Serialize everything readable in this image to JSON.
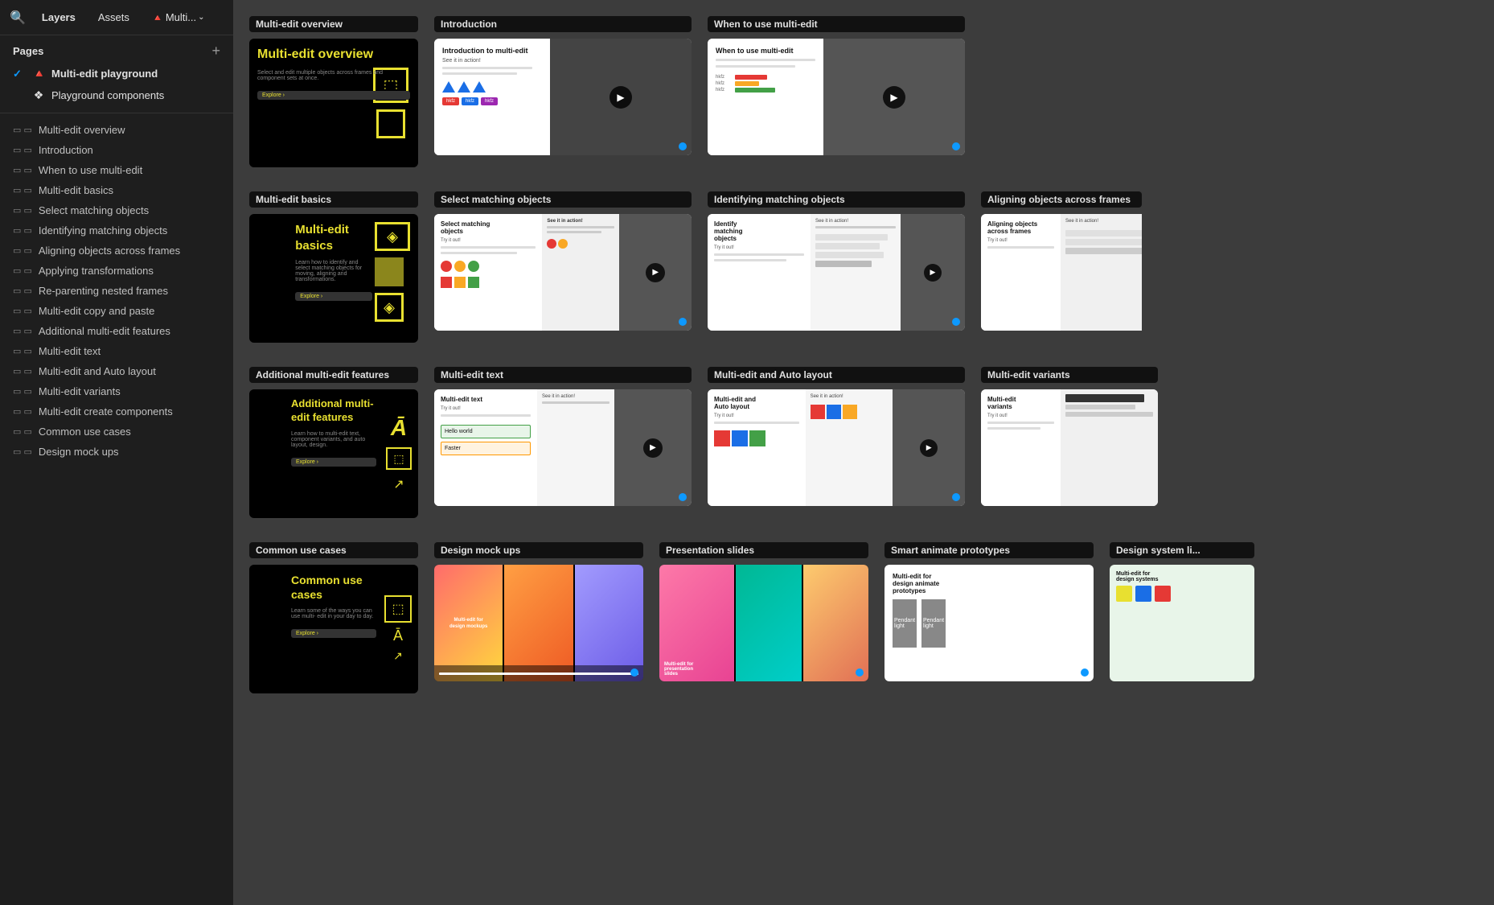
{
  "topbar": {
    "search_icon": "🔍",
    "layers_label": "Layers",
    "assets_label": "Assets",
    "multi_label": "Multi...",
    "chevron": "⌄"
  },
  "sidebar": {
    "pages_label": "Pages",
    "add_icon": "+",
    "pages": [
      {
        "id": "multi-edit-playground",
        "label": "Multi-edit playground",
        "icon": "🔺",
        "active": true,
        "check": "✓"
      },
      {
        "id": "playground-components",
        "label": "Playground components",
        "icon": "❖",
        "active": false
      }
    ],
    "layers": [
      {
        "id": "multi-edit-overview",
        "label": "Multi-edit overview"
      },
      {
        "id": "introduction",
        "label": "Introduction"
      },
      {
        "id": "when-to-use-multi-edit",
        "label": "When to use multi-edit"
      },
      {
        "id": "multi-edit-basics",
        "label": "Multi-edit basics"
      },
      {
        "id": "select-matching-objects",
        "label": "Select matching objects"
      },
      {
        "id": "identifying-matching-objects",
        "label": "Identifying matching objects"
      },
      {
        "id": "aligning-objects-across-frames",
        "label": "Aligning objects across frames"
      },
      {
        "id": "applying-transformations",
        "label": "Applying transformations"
      },
      {
        "id": "re-parenting-nested-frames",
        "label": "Re-parenting nested frames"
      },
      {
        "id": "multi-edit-copy-and-paste",
        "label": "Multi-edit copy and paste"
      },
      {
        "id": "additional-multi-edit-features",
        "label": "Additional multi-edit features"
      },
      {
        "id": "multi-edit-text",
        "label": "Multi-edit text"
      },
      {
        "id": "multi-edit-and-auto-layout",
        "label": "Multi-edit and Auto layout"
      },
      {
        "id": "multi-edit-variants",
        "label": "Multi-edit variants"
      },
      {
        "id": "multi-edit-create-components",
        "label": "Multi-edit create components"
      },
      {
        "id": "common-use-cases",
        "label": "Common use cases"
      },
      {
        "id": "design-mock-ups",
        "label": "Design mock ups"
      }
    ]
  },
  "main": {
    "sections": [
      {
        "id": "row1",
        "main_card": {
          "label": "Multi-edit overview",
          "title": "Multi-edit\noverview",
          "subtitle": "Select and edit multiple objects across frames\nand component sets at once.",
          "btn": "Explore ›",
          "icon": "⬚"
        },
        "sub_cards": [
          {
            "id": "introduction",
            "label": "Introduction",
            "type": "intro"
          },
          {
            "id": "when-to-use",
            "label": "When to use multi-edit",
            "type": "when"
          }
        ]
      },
      {
        "id": "row2",
        "main_card": {
          "label": "Multi-edit basics",
          "title": "Multi-edit\nbasics",
          "subtitle": "Learn how to identify and select matching objects\nfor moving, aligning and transformations.",
          "btn": "Explore ›",
          "icon": "◈"
        },
        "sub_cards": [
          {
            "id": "select-matching",
            "label": "Select matching objects",
            "type": "select"
          },
          {
            "id": "identifying-matching",
            "label": "Identifying matching objects",
            "type": "identify"
          },
          {
            "id": "aligning-objects",
            "label": "Aligning objects across frames",
            "type": "align",
            "truncated": true
          }
        ]
      },
      {
        "id": "row3",
        "main_card": {
          "label": "Additional multi-edit features",
          "title": "Additional\nmulti-edit\nfeatures",
          "subtitle": "Learn how to multi-edit text, component variants,\nand auto layout, design.",
          "btn": "Explore ›",
          "icon": "Ā"
        },
        "sub_cards": [
          {
            "id": "multi-edit-text",
            "label": "Multi-edit text",
            "type": "text"
          },
          {
            "id": "auto-layout",
            "label": "Multi-edit and Auto layout",
            "type": "auto"
          },
          {
            "id": "variants",
            "label": "Multi-edit variants",
            "type": "variants",
            "truncated": true
          }
        ]
      },
      {
        "id": "row4",
        "main_card": {
          "label": "Common use cases",
          "title": "Common\nuse cases",
          "subtitle": "Learn some of the ways you can use multi-\nedit in your day to day.",
          "btn": "Explore ›",
          "icon": "⬚"
        },
        "sub_cards": [
          {
            "id": "design-mock-ups",
            "label": "Design mock ups",
            "type": "mockup"
          },
          {
            "id": "presentation-slides",
            "label": "Presentation slides",
            "type": "presentation"
          },
          {
            "id": "smart-animate",
            "label": "Smart animate prototypes",
            "type": "smart"
          },
          {
            "id": "design-system",
            "label": "Design system li...",
            "type": "design-system",
            "truncated": true
          }
        ]
      }
    ]
  }
}
